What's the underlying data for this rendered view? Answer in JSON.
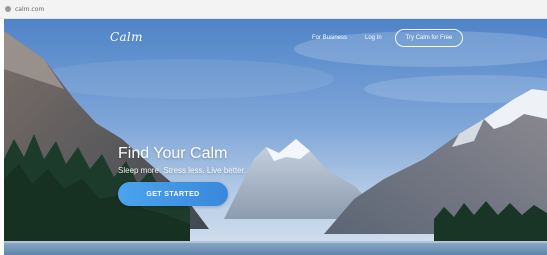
{
  "browser": {
    "url": "calm.com",
    "site_icon": "calm-site-icon"
  },
  "header": {
    "logo": "Calm",
    "nav": {
      "for_business": "For Business",
      "login": "Log In",
      "try_button": "Try Calm for Free"
    }
  },
  "hero": {
    "headline": "Find Your Calm",
    "subheadline": "Sleep more. Stress less. Live better.",
    "cta_label": "GET STARTED",
    "background": "mountain-lake-landscape"
  },
  "colors": {
    "cta_start": "#4aa4ec",
    "cta_end": "#3a88dc",
    "sky_top": "#5d8fd0",
    "lake": "#6f93b7"
  }
}
